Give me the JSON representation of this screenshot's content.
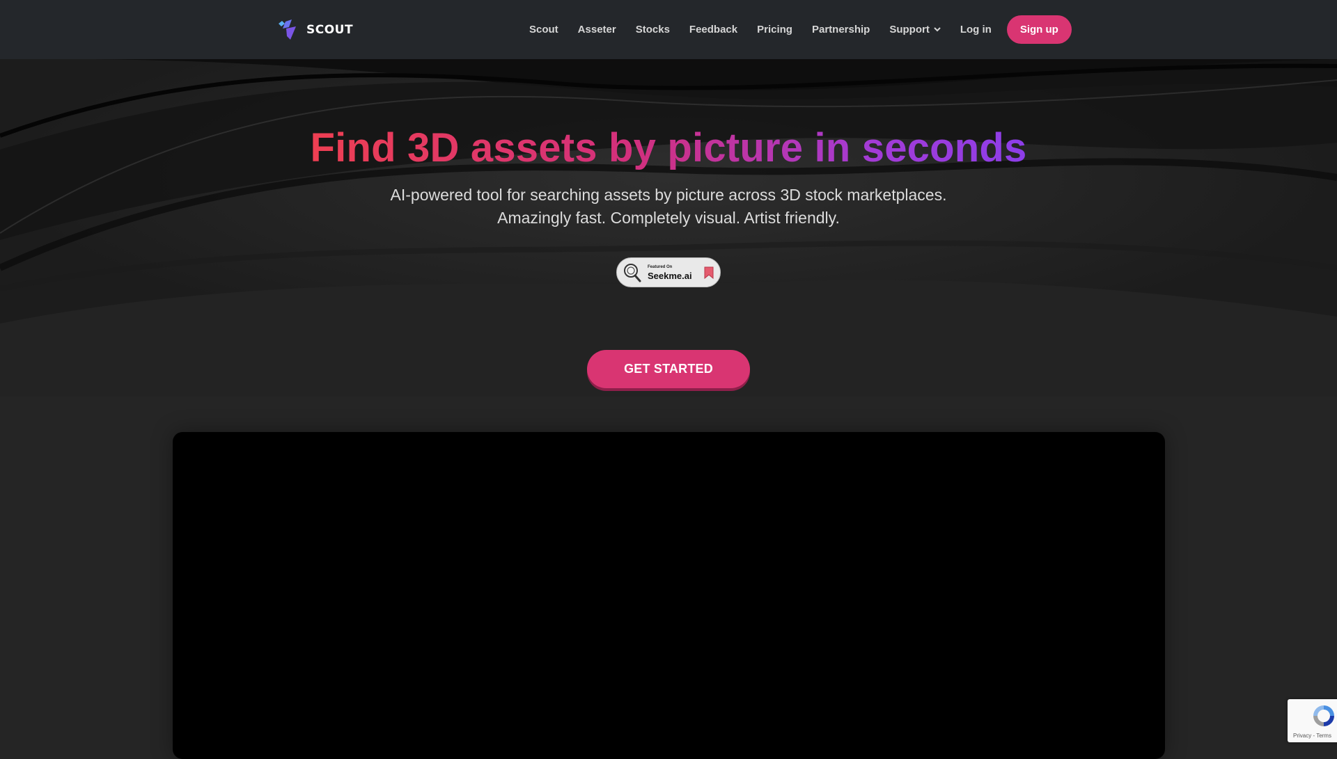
{
  "header": {
    "brand": "SCOUT",
    "nav": [
      {
        "label": "Scout"
      },
      {
        "label": "Asseter"
      },
      {
        "label": "Stocks"
      },
      {
        "label": "Feedback"
      },
      {
        "label": "Pricing"
      },
      {
        "label": "Partnership"
      },
      {
        "label": "Support",
        "icon": "chevron-down-icon"
      }
    ],
    "login_label": "Log in",
    "signup_label": "Sign up"
  },
  "hero": {
    "title": "Find 3D assets by picture in seconds",
    "subtitle_line1": "AI-powered tool for searching assets by picture across 3D stock marketplaces.",
    "subtitle_line2": "Amazingly fast. Completely visual. Artist friendly.",
    "badge": {
      "small_text": "Featured On",
      "name": "Seekme.ai",
      "icon": "magnifier-icon",
      "bookmark_icon": "bookmark-icon"
    },
    "cta_label": "GET STARTED"
  },
  "recaptcha": {
    "links": "Privacy - Terms",
    "icon": "recaptcha-icon"
  },
  "colors": {
    "accent": "#d93572",
    "header_bg": "#24272b",
    "page_bg": "#252525",
    "title_gradient_start": "#ee3f52",
    "title_gradient_end": "#8d3ee9"
  }
}
